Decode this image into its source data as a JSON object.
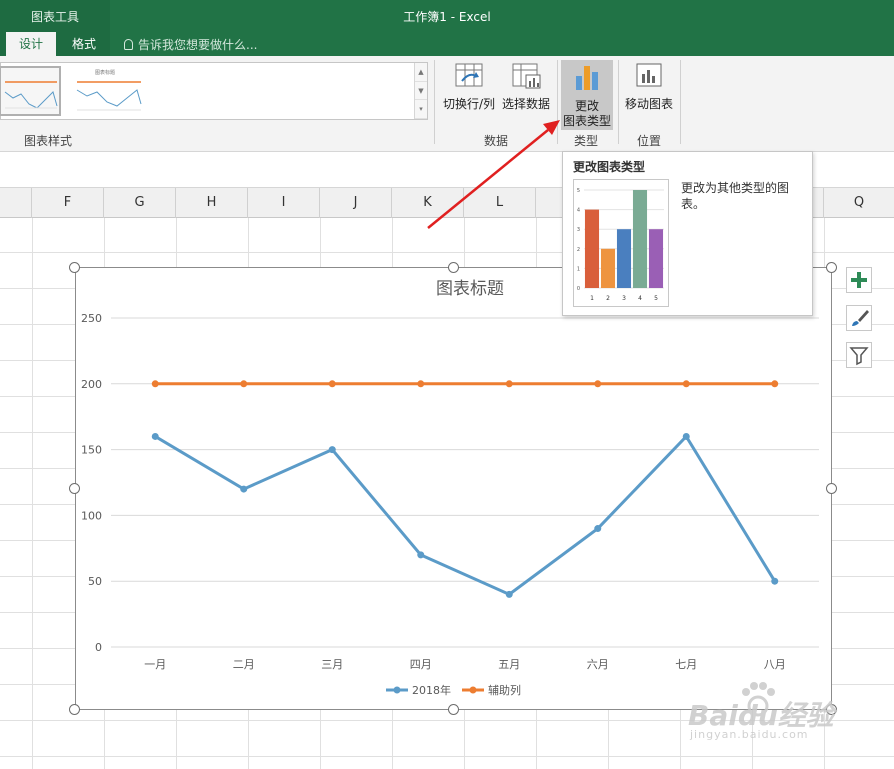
{
  "window": {
    "title": "工作簿1 - Excel",
    "context_group": "图表工具"
  },
  "tabs": [
    {
      "label": "设计",
      "active": true
    },
    {
      "label": "格式",
      "active": false
    }
  ],
  "tell_me": {
    "placeholder": "告诉我您想要做什么..."
  },
  "ribbon": {
    "groups": {
      "styles": "图表样式",
      "data": "数据",
      "type": "类型",
      "location": "位置"
    },
    "buttons": {
      "switch_row_col": "切换行/列",
      "select_data": "选择数据",
      "change_type_line1": "更改",
      "change_type_line2": "图表类型",
      "move_chart": "移动图表"
    },
    "style_thumb2_title": "图表标题"
  },
  "columns": [
    "F",
    "G",
    "H",
    "I",
    "J",
    "K",
    "L",
    "Q"
  ],
  "tooltip": {
    "title": "更改图表类型",
    "description": "更改为其他类型的图表。",
    "preview_chart": {
      "type": "bar",
      "categories": [
        "1",
        "2",
        "3",
        "4",
        "5"
      ],
      "values": [
        4,
        2,
        3,
        5,
        3
      ],
      "ylim": [
        0,
        5
      ],
      "y_ticks": [
        "0",
        "1",
        "2",
        "3",
        "4",
        "5"
      ],
      "colors": [
        "#d95f3b",
        "#ee9440",
        "#4a7fbf",
        "#7aab94",
        "#9a5fb5"
      ]
    }
  },
  "chart_data": {
    "type": "line",
    "title": "图表标题",
    "categories": [
      "一月",
      "二月",
      "三月",
      "四月",
      "五月",
      "六月",
      "七月",
      "八月"
    ],
    "series": [
      {
        "name": "2018年",
        "values": [
          160,
          120,
          150,
          70,
          40,
          90,
          160,
          50
        ],
        "color": "#5b9bc8"
      },
      {
        "name": "辅助列",
        "values": [
          200,
          200,
          200,
          200,
          200,
          200,
          200,
          200
        ],
        "color": "#ed7d31"
      }
    ],
    "ylim": [
      0,
      250
    ],
    "y_ticks": [
      "0",
      "50",
      "100",
      "150",
      "200",
      "250"
    ],
    "grid": true,
    "legend": "bottom"
  },
  "colors": {
    "excel_green": "#217346",
    "arrow": "#e02020"
  },
  "watermark": {
    "text": "Baidu经验",
    "subtext": "jingyan.baidu.com"
  }
}
